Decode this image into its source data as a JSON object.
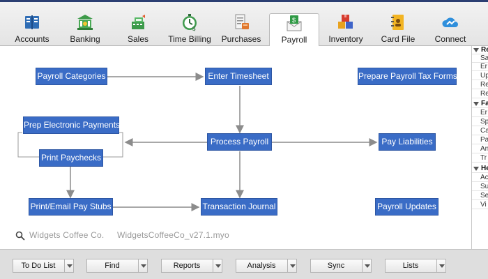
{
  "tabs": [
    {
      "label": "Accounts",
      "icon": "ledger-icon"
    },
    {
      "label": "Banking",
      "icon": "bank-icon"
    },
    {
      "label": "Sales",
      "icon": "cash-register-icon"
    },
    {
      "label": "Time Billing",
      "icon": "stopwatch-icon"
    },
    {
      "label": "Purchases",
      "icon": "receipt-icon"
    },
    {
      "label": "Payroll",
      "icon": "pay-envelope-icon",
      "active": true
    },
    {
      "label": "Inventory",
      "icon": "boxes-icon"
    },
    {
      "label": "Card File",
      "icon": "address-book-icon"
    },
    {
      "label": "Connect",
      "icon": "cloud-sync-icon"
    }
  ],
  "flow": {
    "payroll_categories": "Payroll Categories",
    "enter_timesheet": "Enter Timesheet",
    "prepare_tax_forms": "Prepare Payroll Tax Forms",
    "prep_electronic_payments": "Prep Electronic Payments",
    "print_paychecks": "Print Paychecks",
    "process_payroll": "Process Payroll",
    "pay_liabilities": "Pay Liabilities",
    "print_email_pay_stubs": "Print/Email Pay Stubs",
    "transaction_journal": "Transaction Journal",
    "payroll_updates": "Payroll Updates"
  },
  "company": {
    "name": "Widgets Coffee Co.",
    "file": "WidgetsCoffeeCo_v27.1.myo"
  },
  "side_panel": [
    {
      "text": "Re",
      "header": true
    },
    {
      "text": "Sa"
    },
    {
      "text": "Er"
    },
    {
      "text": "Up"
    },
    {
      "text": "Re"
    },
    {
      "text": "Re"
    },
    {
      "text": "Fa",
      "header": true
    },
    {
      "text": "Er"
    },
    {
      "text": "Sp"
    },
    {
      "text": "Ca"
    },
    {
      "text": "Pa"
    },
    {
      "text": "An"
    },
    {
      "text": "Tr"
    },
    {
      "text": "He",
      "header": true
    },
    {
      "text": "Ac"
    },
    {
      "text": "Su"
    },
    {
      "text": "Se"
    },
    {
      "text": "Vi"
    }
  ],
  "bottom_buttons": [
    "To Do List",
    "Find",
    "Reports",
    "Analysis",
    "Sync",
    "Lists"
  ],
  "colors": {
    "node_blue": "#3a6cc6",
    "connector_gray": "#8c8c8c",
    "top_accent": "#2c3f73"
  }
}
